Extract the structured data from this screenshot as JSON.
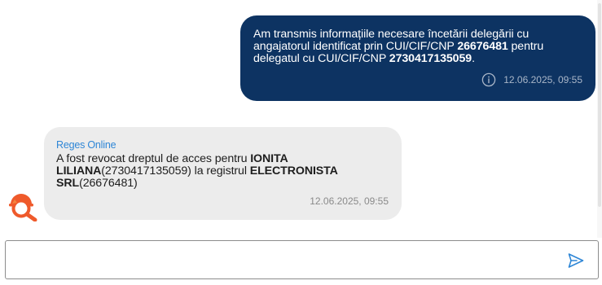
{
  "messages": {
    "outgoing": {
      "text_before": "Am transmis informațiile necesare încetării delegării cu angajatorul identificat prin CUI/CIF/CNP ",
      "employer_id": "26676481",
      "text_middle": " pentru delegatul cu CUI/CIF/CNP ",
      "delegate_id": "2730417135059",
      "text_end": ".",
      "timestamp": "12.06.2025, 09:55",
      "info_icon": "info-icon"
    },
    "incoming": {
      "sender": "Reges Online",
      "text_before": "A fost revocat dreptul de acces pentru ",
      "person_name": "IONITA LILIANA",
      "person_id": "(2730417135059)",
      "text_middle": " la registrul ",
      "company_name": "ELECTRONISTA SRL",
      "company_id": "(26676481)",
      "timestamp": "12.06.2025, 09:55",
      "avatar_icon": "bot-avatar-icon"
    }
  },
  "composer": {
    "value": "",
    "placeholder": "",
    "send_icon": "send-icon"
  },
  "colors": {
    "outgoing_bubble": "#0d3362",
    "incoming_bubble": "#ececec",
    "sender_name": "#2e86d6",
    "avatar_orange": "#ef5a2b",
    "send_icon": "#2e86d6"
  }
}
